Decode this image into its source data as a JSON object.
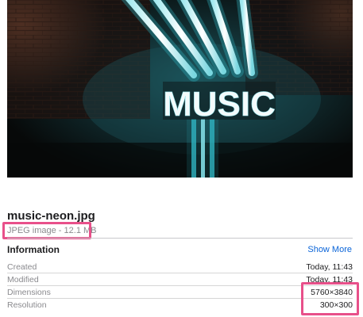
{
  "preview": {
    "sign_text": "MUSIC"
  },
  "file": {
    "name": "music-neon.jpg",
    "kind": "JPEG image - 12.1 MB"
  },
  "info": {
    "title": "Information",
    "show_more": "Show More",
    "rows": [
      {
        "label": "Created",
        "value": "Today, 11:43"
      },
      {
        "label": "Modified",
        "value": "Today, 11:43"
      },
      {
        "label": "Dimensions",
        "value": "5760×3840"
      },
      {
        "label": "Resolution",
        "value": "300×300"
      }
    ]
  },
  "colors": {
    "highlight": "#e8508a",
    "link": "#0a64d8",
    "neon": "#37c6d2"
  }
}
